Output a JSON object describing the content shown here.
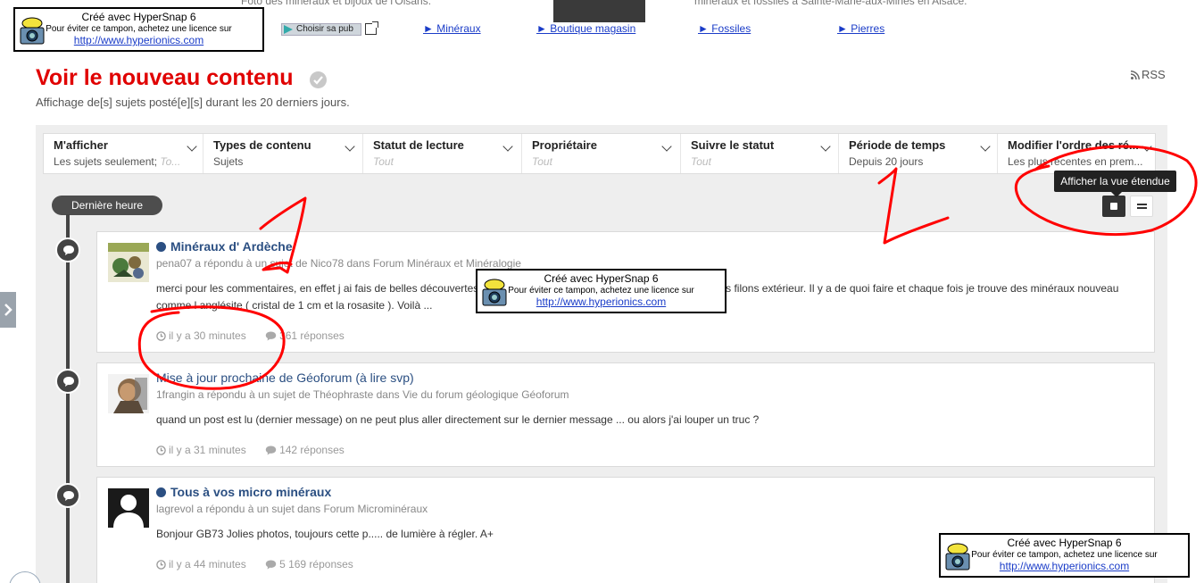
{
  "top_strip": {
    "faded_left": "Foto des minéraux et bijoux de l'Oisans.",
    "faded_right": "minéraux et fossiles à Sainte-Marie-aux-Mines en Alsace.",
    "ad_button": "Choisir sa pub",
    "links": [
      {
        "label": "► Minéraux"
      },
      {
        "label": "► Boutique magasin"
      },
      {
        "label": "► Fossiles"
      },
      {
        "label": "► Pierres"
      }
    ]
  },
  "hypersnap": {
    "line1": "Créé avec HyperSnap 6",
    "line2": "Pour éviter ce tampon, achetez une licence sur",
    "line3": "http://www.hyperionics.com"
  },
  "header": {
    "title": "Voir le nouveau contenu",
    "subtitle": "Affichage de[s] sujets posté[e][s] durant les 20 derniers jours.",
    "rss": "RSS"
  },
  "filters": [
    {
      "label": "M'afficher",
      "value": "Les sujets seulement;",
      "value_muted": "To..."
    },
    {
      "label": "Types de contenu",
      "value": "Sujets"
    },
    {
      "label": "Statut de lecture",
      "value_muted": "Tout"
    },
    {
      "label": "Propriétaire",
      "value_muted": "Tout"
    },
    {
      "label": "Suivre le statut",
      "value_muted": "Tout"
    },
    {
      "label": "Période de temps",
      "value": "Depuis 20 jours"
    },
    {
      "label": "Modifier l'ordre des ré...",
      "value": "Les plus récentes en prem..."
    }
  ],
  "timeline_label": "Dernière heure",
  "tooltip": "Afficher la vue étendue",
  "items": [
    {
      "title": "Minéraux d' Ardèche",
      "unread": true,
      "meta": "pena07 a répondu à un sujet de Nico78 dans Forum Minéraux et Minéralogie",
      "body": "merci pour les commentaires, en effet j ai fais de belles découvertes dans les filons en altitude. Je cherche aussi dans les filons extérieur. Il y a de quoi faire et chaque fois je trouve des minéraux nouveau comme l anglésite ( cristal de 1 cm et la rosasite ). Voilà ...",
      "time": "il y a 30 minutes",
      "replies": "361 réponses"
    },
    {
      "title": "Mise à jour prochaine de Géoforum (à lire svp)",
      "unread": false,
      "meta": "1frangin a répondu à un sujet de Théophraste dans Vie du forum géologique Géoforum",
      "body": "quand un post est lu (dernier message) on ne peut plus aller directement sur le dernier message ... ou alors j'ai louper un truc ?",
      "time": "il y a 31 minutes",
      "replies": "142 réponses"
    },
    {
      "title": "Tous à vos micro minéraux",
      "unread": true,
      "meta": "lagrevol a répondu à un sujet dans Forum Microminéraux",
      "body": "Bonjour GB73 Jolies photos, toujours cette p..... de lumière à régler. A+",
      "time": "il y a 44 minutes",
      "replies": "5 169 réponses"
    }
  ],
  "colors": {
    "title_red": "#e00000",
    "link_blue": "#2b4f82",
    "annotation_red": "#ff0000"
  }
}
